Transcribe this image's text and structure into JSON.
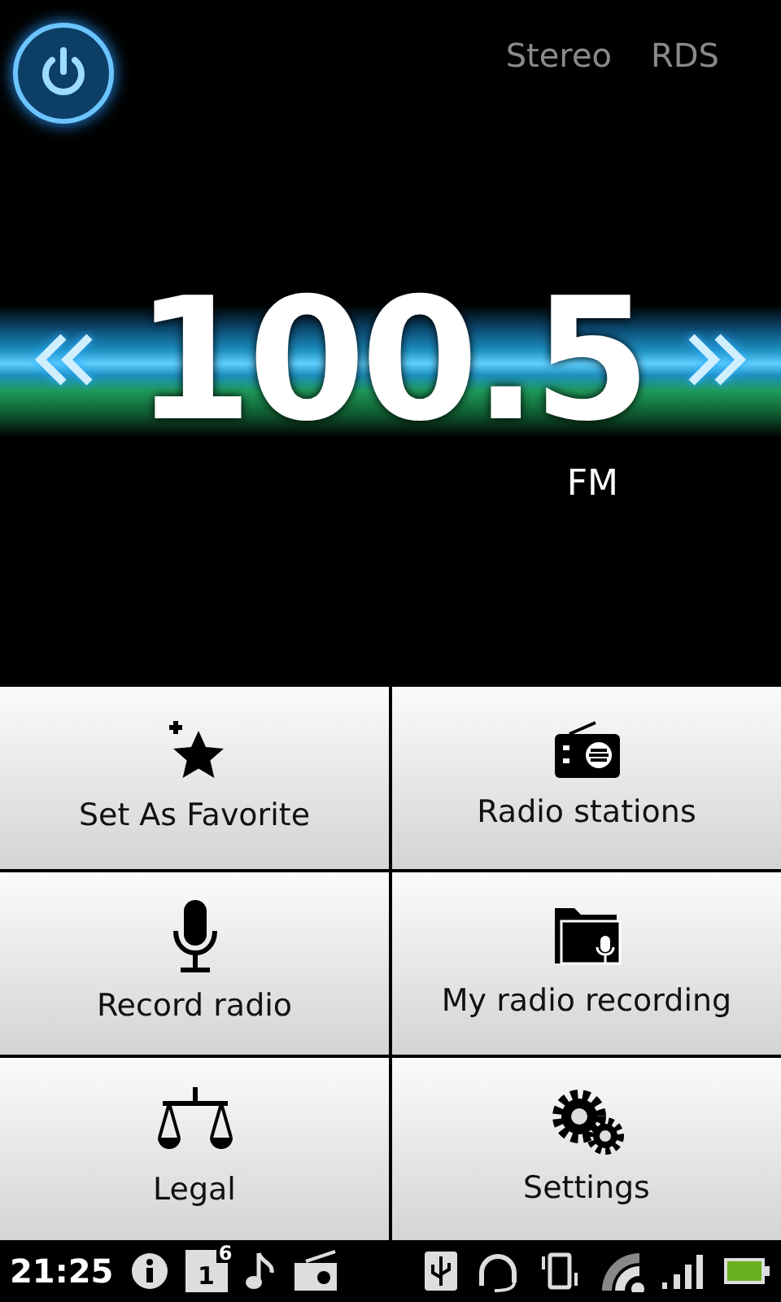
{
  "header": {
    "indicators": [
      "Stereo",
      "RDS"
    ]
  },
  "tuner": {
    "frequency": "100.5",
    "band": "FM"
  },
  "menu": [
    {
      "kind": "favorite",
      "label": "Set As Favorite"
    },
    {
      "kind": "stations",
      "label": "Radio stations"
    },
    {
      "kind": "record",
      "label": "Record radio"
    },
    {
      "kind": "recordings",
      "label": "My radio recording"
    },
    {
      "kind": "legal",
      "label": "Legal"
    },
    {
      "kind": "settings",
      "label": "Settings"
    }
  ],
  "status_bar": {
    "time": "21:25",
    "calendar_day": "1",
    "calendar_count": "6"
  }
}
